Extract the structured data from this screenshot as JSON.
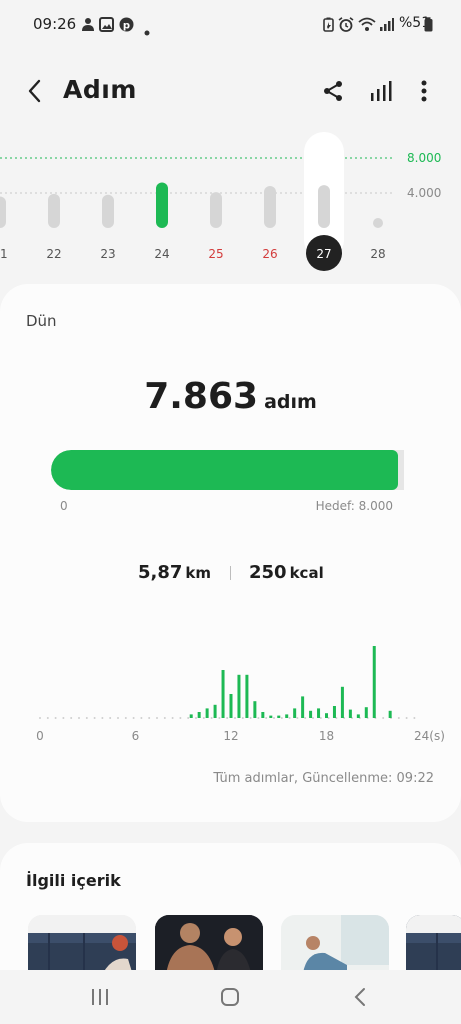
{
  "status_bar": {
    "time": "09:26",
    "battery_text": "%51"
  },
  "header": {
    "title": "Adım"
  },
  "week_chart": {
    "gridline_labels": [
      "8.000",
      "4.000"
    ],
    "days": [
      {
        "label": "21",
        "value": 3600,
        "color": "#d6d6d6",
        "text_color": "#555555"
      },
      {
        "label": "22",
        "value": 3900,
        "color": "#d6d6d6",
        "text_color": "#555555"
      },
      {
        "label": "23",
        "value": 3800,
        "color": "#d6d6d6",
        "text_color": "#555555"
      },
      {
        "label": "24",
        "value": 5200,
        "color": "#1db954",
        "text_color": "#555555"
      },
      {
        "label": "25",
        "value": 4100,
        "color": "#d6d6d6",
        "text_color": "#d33c3c"
      },
      {
        "label": "26",
        "value": 4800,
        "color": "#d6d6d6",
        "text_color": "#d33c3c"
      },
      {
        "label": "27",
        "value": 4900,
        "color": "#d6d6d6",
        "text_color": "#ffffff"
      },
      {
        "label": "28",
        "value": 0,
        "color": "#d6d6d6",
        "text_color": "#555555"
      }
    ]
  },
  "summary": {
    "day_label": "Dün",
    "steps": "7.863",
    "steps_unit": "adım",
    "progress_fraction": 0.983,
    "progress_min": "0",
    "goal_label": "Hedef: 8.000",
    "distance": "5,87",
    "distance_unit": "km",
    "calories": "250",
    "calories_unit": "kcal",
    "updated_text": "Tüm adımlar, Güncellenme: 09:22"
  },
  "chart_data": {
    "type": "bar",
    "x_tick_labels": [
      "0",
      "6",
      "12",
      "18",
      "24(s)"
    ],
    "xlim": [
      0,
      24
    ],
    "x": [
      9.5,
      10,
      10.5,
      11,
      11.5,
      12,
      12.5,
      13,
      13.5,
      14,
      14.5,
      15,
      15.5,
      16,
      16.5,
      17,
      17.5,
      18,
      18.5,
      19,
      19.5,
      20,
      20.5,
      21,
      21.5,
      22
    ],
    "values": [
      3,
      5,
      8,
      11,
      40,
      20,
      36,
      36,
      14,
      5,
      2,
      2,
      3,
      8,
      18,
      6,
      8,
      4,
      10,
      26,
      7,
      3,
      9,
      60,
      0,
      6
    ],
    "color": "#1db954"
  },
  "related": {
    "title": "İlgili içerik"
  },
  "colors": {
    "accent": "#1db954",
    "weekend": "#d33c3c"
  }
}
